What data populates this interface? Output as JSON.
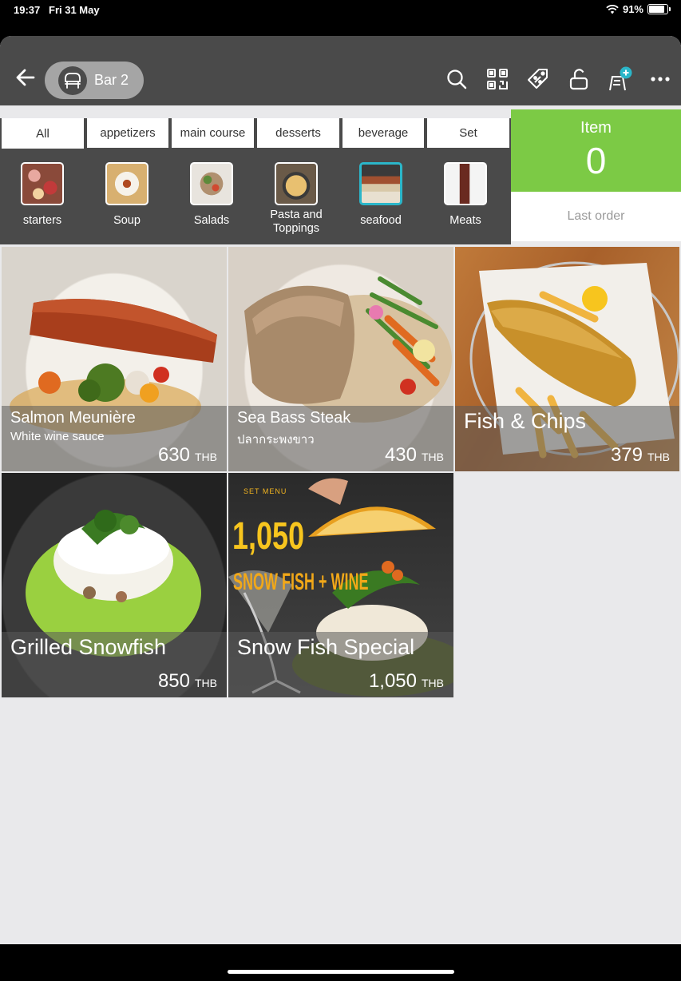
{
  "status_bar": {
    "time": "19:37",
    "date": "Fri 31 May",
    "battery": "91%"
  },
  "header": {
    "table_name": "Bar 2",
    "icons": [
      "search-icon",
      "qr-code-icon",
      "discount-tag-icon",
      "unlock-icon",
      "add-order-icon",
      "more-icon"
    ]
  },
  "tabs": [
    "All",
    "appetizers",
    "main course",
    "desserts",
    "beverage",
    "Set"
  ],
  "categories": [
    {
      "name": "starters"
    },
    {
      "name": "Soup"
    },
    {
      "name": "Salads"
    },
    {
      "name": "Pasta and Toppings"
    },
    {
      "name": "seafood"
    },
    {
      "name": "Meats"
    }
  ],
  "item_panel": {
    "label": "Item",
    "count": "0",
    "last_order": "Last order"
  },
  "menu_items": [
    {
      "title": "Salmon Meunière",
      "subtitle": "White wine sauce",
      "price": "630",
      "currency": "THB"
    },
    {
      "title": "Sea Bass Steak",
      "subtitle": "ปลากระพงขาว",
      "price": "430",
      "currency": "THB"
    },
    {
      "title": "Fish & Chips",
      "subtitle": "",
      "price": "379",
      "currency": "THB"
    },
    {
      "title": "Grilled Snowfish",
      "subtitle": "",
      "price": "850",
      "currency": "THB"
    },
    {
      "title": "Snow Fish Special",
      "subtitle": "",
      "price": "1,050",
      "currency": "THB"
    }
  ],
  "promo_art": {
    "tag": "SET MENU",
    "price": "1,050",
    "text": "SNOW FISH + WINE"
  },
  "colors": {
    "accent_green": "#7cca45",
    "active_teal": "#2bb6c9",
    "header_gray": "#4a4a4a"
  }
}
